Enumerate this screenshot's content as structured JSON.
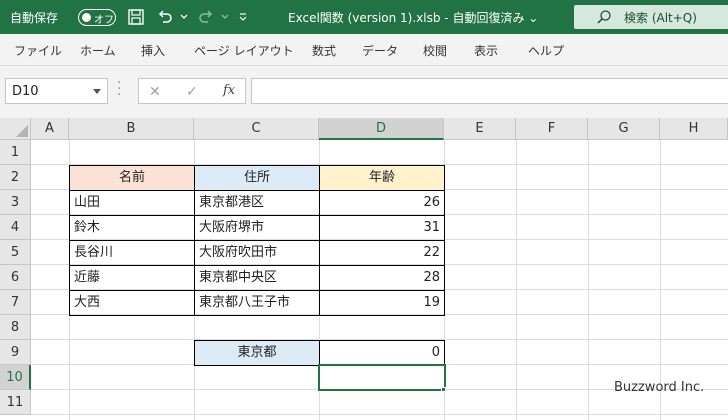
{
  "titlebar": {
    "autosave_label": "自動保存",
    "autosave_state": "オフ",
    "doc_title": "Excel関数 (version 1).xlsb  -  自動回復済み  ⌄",
    "search_placeholder": "検索 (Alt+Q)",
    "colors": {
      "brand": "#217346"
    }
  },
  "ribbon": {
    "tabs": [
      "ファイル",
      "ホーム",
      "挿入",
      "ページ レイアウト",
      "数式",
      "データ",
      "校閲",
      "表示",
      "ヘルプ"
    ]
  },
  "formula_bar": {
    "name_box": "D10",
    "cancel_icon": "✕",
    "enter_icon": "✓",
    "fx_label": "fx",
    "formula": ""
  },
  "sheet": {
    "columns": [
      "A",
      "B",
      "C",
      "D",
      "E",
      "F",
      "G",
      "H"
    ],
    "rows": [
      "1",
      "2",
      "3",
      "4",
      "5",
      "6",
      "7",
      "8",
      "9",
      "10",
      "11"
    ],
    "selected_column": "D",
    "selected_row": "10",
    "headers": {
      "name": "名前",
      "address": "住所",
      "age": "年齢"
    },
    "records": [
      {
        "name": "山田",
        "address": "東京都港区",
        "age": "26"
      },
      {
        "name": "鈴木",
        "address": "大阪府堺市",
        "age": "31"
      },
      {
        "name": "長谷川",
        "address": "大阪府吹田市",
        "age": "22"
      },
      {
        "name": "近藤",
        "address": "東京都中央区",
        "age": "28"
      },
      {
        "name": "大西",
        "address": "東京都八王子市",
        "age": "19"
      }
    ],
    "criteria_label": "東京都",
    "criteria_result": "0",
    "header_colors": {
      "name": "#fbe2d5",
      "address": "#ddebf7",
      "age": "#fff2cc"
    },
    "criteria_color": "#ddebf7"
  },
  "watermark": "Buzzword Inc."
}
